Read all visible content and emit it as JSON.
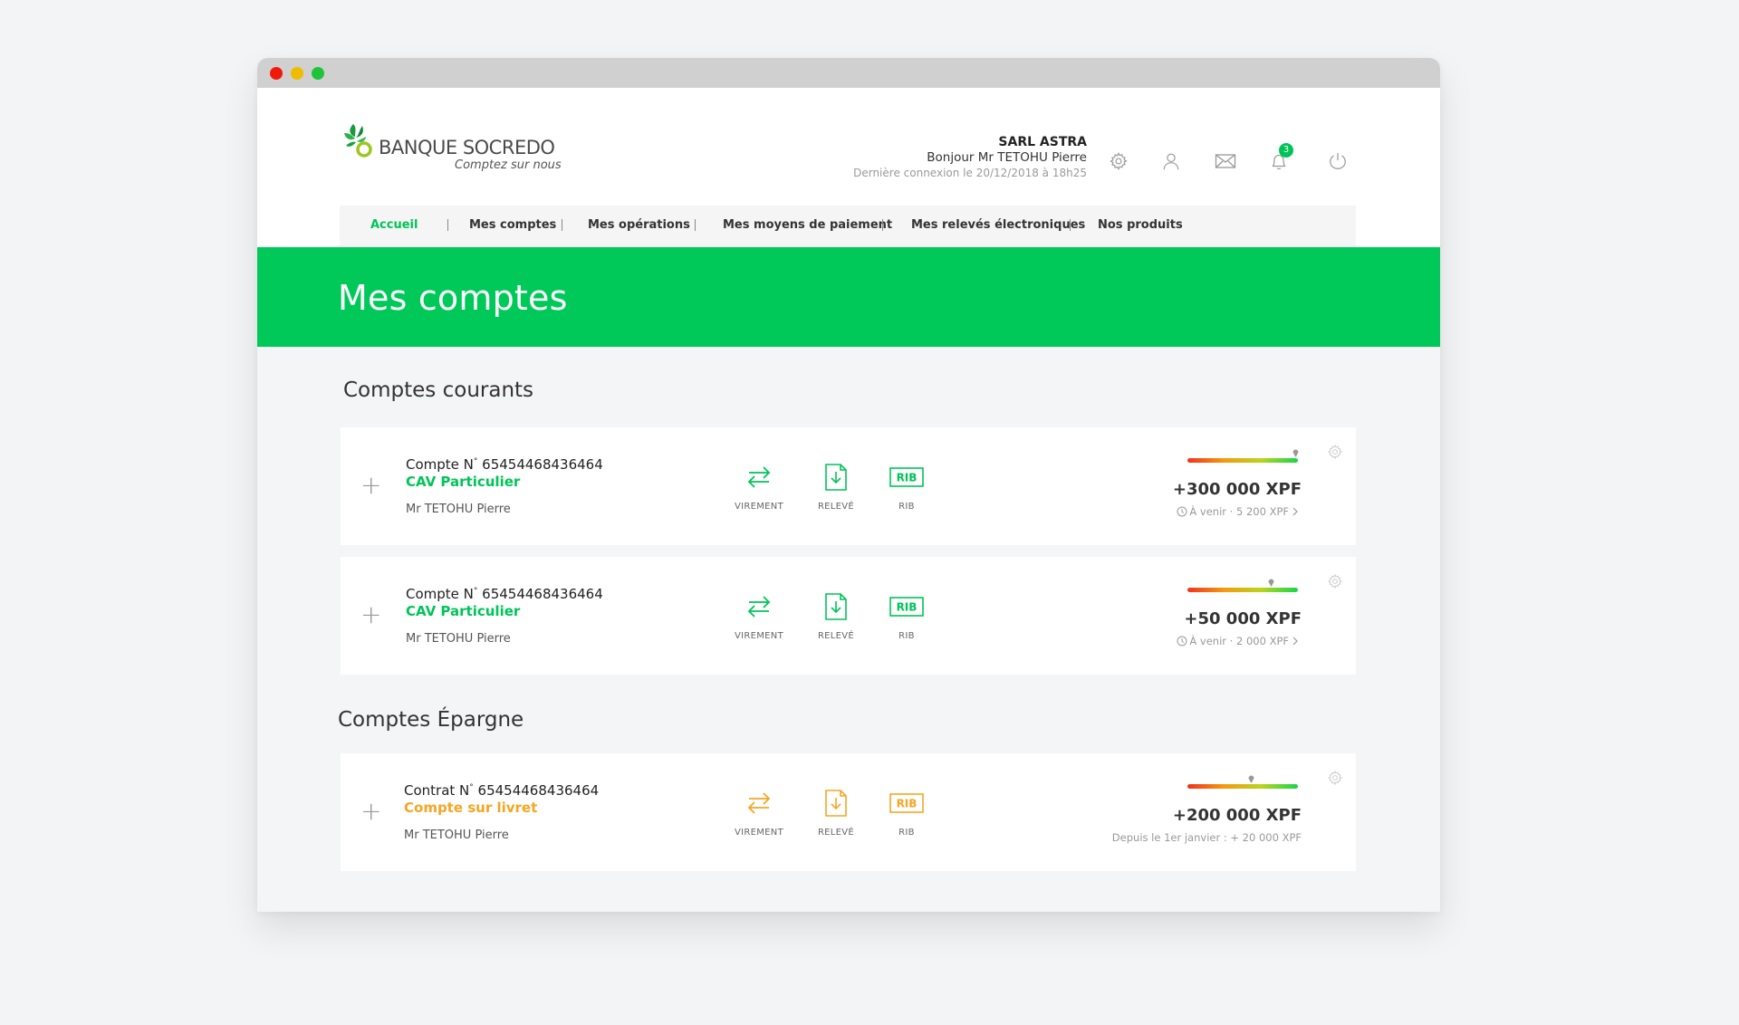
{
  "brand": {
    "name": "BANQUE SOCREDO",
    "tagline": "Comptez sur nous",
    "color_green": "#00c95a",
    "color_orange": "#f5a623"
  },
  "user": {
    "company": "SARL ASTRA",
    "greeting": "Bonjour Mr TETOHU Pierre",
    "last_login": "Dernière connexion le 20/12/2018 à 18h25",
    "notifications_count": "3"
  },
  "header_icons": [
    "gear-icon",
    "user-icon",
    "mail-icon",
    "bell-icon",
    "power-icon"
  ],
  "nav": {
    "items": [
      {
        "label": "Accueil",
        "active": true
      },
      {
        "label": "Mes comptes"
      },
      {
        "label": "Mes opérations"
      },
      {
        "label": "Mes moyens de paiement"
      },
      {
        "label": "Mes relevés électroniques"
      },
      {
        "label": "Nos produits"
      }
    ]
  },
  "page_title": "Mes comptes",
  "sections": {
    "courants": {
      "title": "Comptes courants",
      "accounts": [
        {
          "number_label": "Compte N",
          "number_sup": "°",
          "number": " 65454468436464",
          "type": "CAV Particulier",
          "owner": "Mr TETOHU Pierre",
          "actions": [
            "VIREMENT",
            "RELEVÉ",
            "RIB"
          ],
          "rib_icon_text": "RIB",
          "balance": "+300 000 XPF",
          "pending": "À venir · 5 200 XPF",
          "gauge_level": 0.98
        },
        {
          "number_label": "Compte N",
          "number_sup": "°",
          "number": " 65454468436464",
          "type": "CAV Particulier",
          "owner": "Mr TETOHU Pierre",
          "actions": [
            "VIREMENT",
            "RELEVÉ",
            "RIB"
          ],
          "rib_icon_text": "RIB",
          "balance": "+50 000 XPF",
          "pending": "À venir · 2 000 XPF",
          "gauge_level": 0.76
        }
      ]
    },
    "epargne": {
      "title": "Comptes Épargne",
      "accounts": [
        {
          "number_label": "Contrat N",
          "number_sup": "°",
          "number": " 65454468436464",
          "type": "Compte sur livret",
          "owner": "Mr TETOHU Pierre",
          "actions": [
            "VIREMENT",
            "RELEVÉ",
            "RIB"
          ],
          "rib_icon_text": "RIB",
          "balance": "+200 000 XPF",
          "since": "Depuis le 1er janvier : + 20 000 XPF",
          "gauge_level": 0.58
        }
      ]
    }
  }
}
